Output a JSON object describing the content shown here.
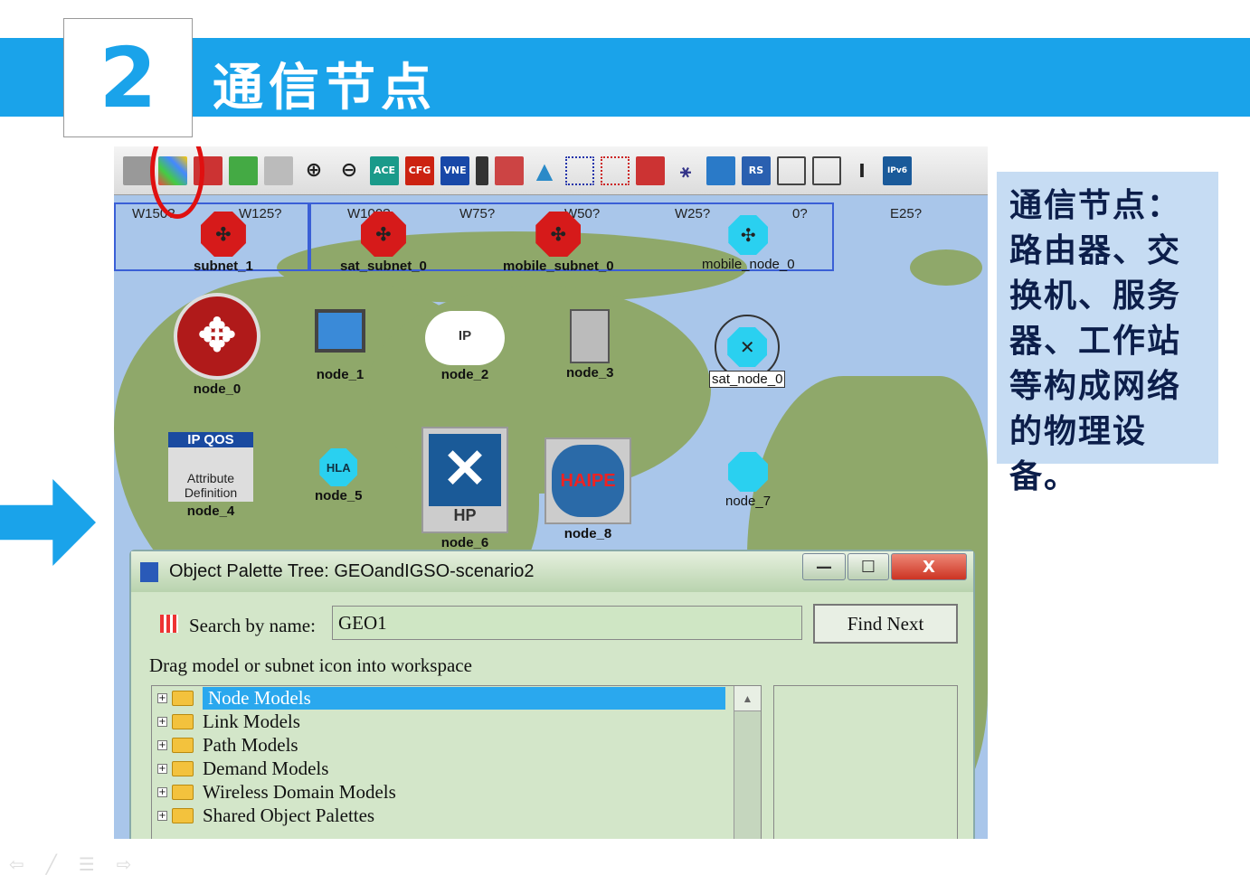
{
  "slide": {
    "number": "2",
    "title": "通信节点",
    "note": "通信节点：路由器、交换机、服务器、工作站等构成网络的物理设备。"
  },
  "toolbar": {
    "icons": [
      "print-icon",
      "object-palette-icon",
      "delete-icon",
      "verify-links-icon",
      "failure-icon",
      "zoom-in-icon",
      "zoom-out-icon",
      "ace-icon",
      "cfg-icon",
      "vne-icon",
      "traffic-light-icon",
      "import-icon",
      "triangle-icon",
      "select-nodes-icon",
      "remove-nodes-icon",
      "pin-icon",
      "topology-icon",
      "gear-icon",
      "rsvp-icon",
      "results-icon",
      "graph-icon",
      "info-icon",
      "ipv6-icon",
      "ip-icon"
    ],
    "labels": {
      "ace": "ACE",
      "cfg": "CFG",
      "vne": "VNE",
      "rs": "RS",
      "ipv6": "IPv6"
    }
  },
  "map": {
    "longitudes": [
      "W150?",
      "W125?",
      "W100?",
      "W75?",
      "W50?",
      "W25?",
      "0?",
      "E25?"
    ],
    "nodes": [
      {
        "id": "subnet_1"
      },
      {
        "id": "sat_subnet_0"
      },
      {
        "id": "mobile_subnet_0"
      },
      {
        "id": "mobile_node_0"
      },
      {
        "id": "node_0"
      },
      {
        "id": "node_1"
      },
      {
        "id": "node_2",
        "badge": "IP"
      },
      {
        "id": "node_3"
      },
      {
        "id": "sat_node_0"
      },
      {
        "id": "node_4",
        "badge": "IP QOS",
        "caption": "Attribute Definition"
      },
      {
        "id": "node_5",
        "badge": "HLA"
      },
      {
        "id": "node_6",
        "badge": "HP"
      },
      {
        "id": "node_7"
      },
      {
        "id": "node_8",
        "badge": "HAIPE"
      }
    ]
  },
  "dialog": {
    "title": "Object Palette Tree: GEOandIGSO-scenario2",
    "search_label": "Search by name:",
    "search_value": "GEO1",
    "find_next": "Find Next",
    "hint": "Drag model or subnet icon into workspace",
    "tree": [
      {
        "label": "Node Models",
        "selected": true
      },
      {
        "label": "Link Models"
      },
      {
        "label": "Path Models"
      },
      {
        "label": "Demand Models"
      },
      {
        "label": "Wireless Domain Models"
      },
      {
        "label": "Shared Object Palettes"
      }
    ],
    "minimize": "—",
    "maximize": "☐",
    "close": "X"
  },
  "colors": {
    "accent": "#1aa3ea",
    "highlight": "#e01010",
    "dialog_bg": "#d3e6c9"
  }
}
